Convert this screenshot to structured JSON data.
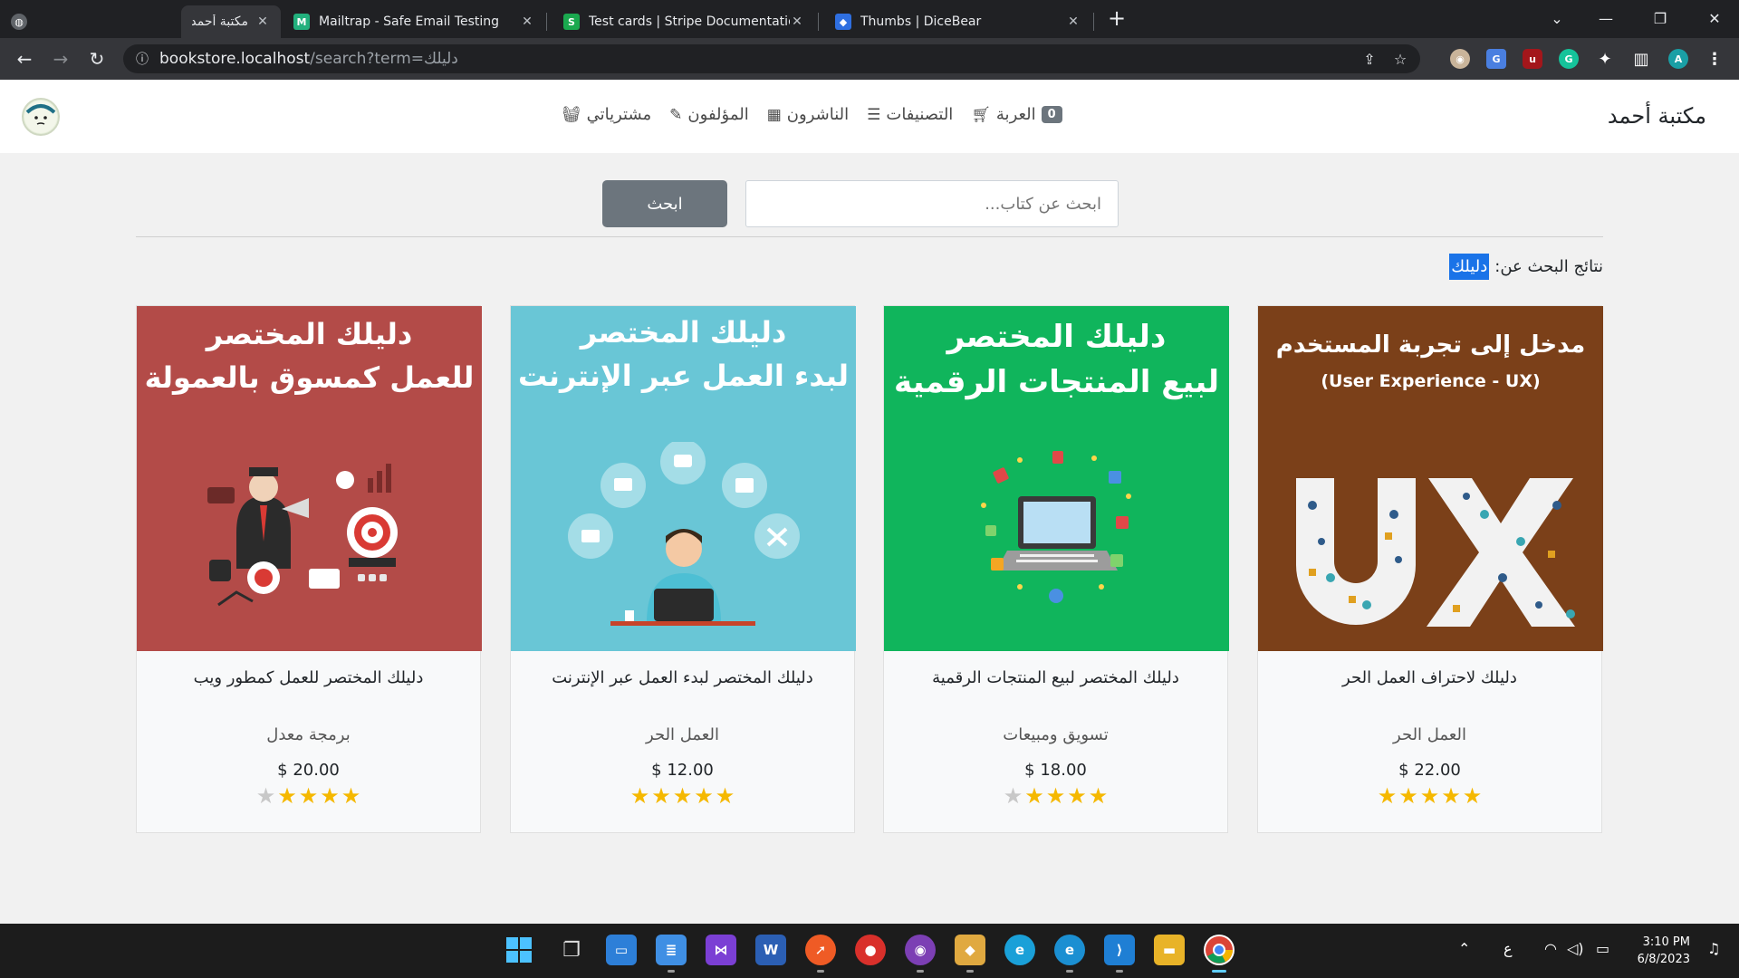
{
  "browser": {
    "tabs": [
      {
        "title": "مكتبة أحمد",
        "icon": "globe-icon",
        "active": true
      },
      {
        "title": "Mailtrap - Safe Email Testing",
        "icon": "mailtrap-icon",
        "active": false
      },
      {
        "title": "Test cards | Stripe Documentation",
        "icon": "stripe-icon",
        "active": false
      },
      {
        "title": "Thumbs | DiceBear",
        "icon": "dicebear-icon",
        "active": false
      }
    ],
    "new_tab": "+",
    "url_host": "bookstore.localhost",
    "url_rest": "/search?term=دليلك",
    "profile_initial": "A"
  },
  "navbar": {
    "brand": "مكتبة أحمد",
    "cart_label": "العربة",
    "cart_count": "0",
    "categories_label": "التصنيفات",
    "publishers_label": "الناشرون",
    "authors_label": "المؤلفون",
    "purchases_label": "مشترياتي"
  },
  "search": {
    "placeholder": "ابحث عن كتاب...",
    "button_label": "ابحث",
    "results_prefix": "نتائج البحث عن:",
    "results_term": "دليلك"
  },
  "books": [
    {
      "cover_color": "#7b4019",
      "cover_line1": "مدخل إلى تجربة المستخدم",
      "cover_line2": "(User Experience - UX)",
      "cover_art": "UX",
      "title": "دليلك لاحتراف العمل الحر",
      "category": "العمل الحر",
      "price": "$ 22.00",
      "rating": 5
    },
    {
      "cover_color": "#10b55c",
      "cover_line1": "دليلك المختصر",
      "cover_line2": "لبيع المنتجات الرقمية",
      "cover_art": "laptop",
      "title": "دليلك المختصر لبيع المنتجات الرقمية",
      "category": "تسويق ومبيعات",
      "price": "$ 18.00",
      "rating": 4
    },
    {
      "cover_color": "#69c6d6",
      "cover_line1": "دليلك المختصر",
      "cover_line2": "لبدء العمل عبر الإنترنت",
      "cover_art": "person",
      "title": "دليلك المختصر لبدء العمل عبر الإنترنت",
      "category": "العمل الحر",
      "price": "$ 12.00",
      "rating": 5
    },
    {
      "cover_color": "#b34b48",
      "cover_line1": "دليلك المختصر",
      "cover_line2": "للعمل كمسوق بالعمولة",
      "cover_art": "marketer",
      "title": "دليلك المختصر للعمل كمطور ويب",
      "category": "برمجة معدل",
      "price": "$ 20.00",
      "rating": 4
    }
  ],
  "taskbar": {
    "apps": [
      "windows-start-icon",
      "task-view-icon",
      "desktop-icon",
      "notepad-icon",
      "visual-studio-icon",
      "word-icon",
      "postman-icon",
      "tomato-icon",
      "github-desktop-icon",
      "dbeaver-icon",
      "edge-dev-icon",
      "edge-icon",
      "vscode-icon",
      "file-explorer-icon",
      "chrome-icon"
    ],
    "lang": "ع",
    "time": "3:10 PM",
    "date": "6/8/2023"
  }
}
